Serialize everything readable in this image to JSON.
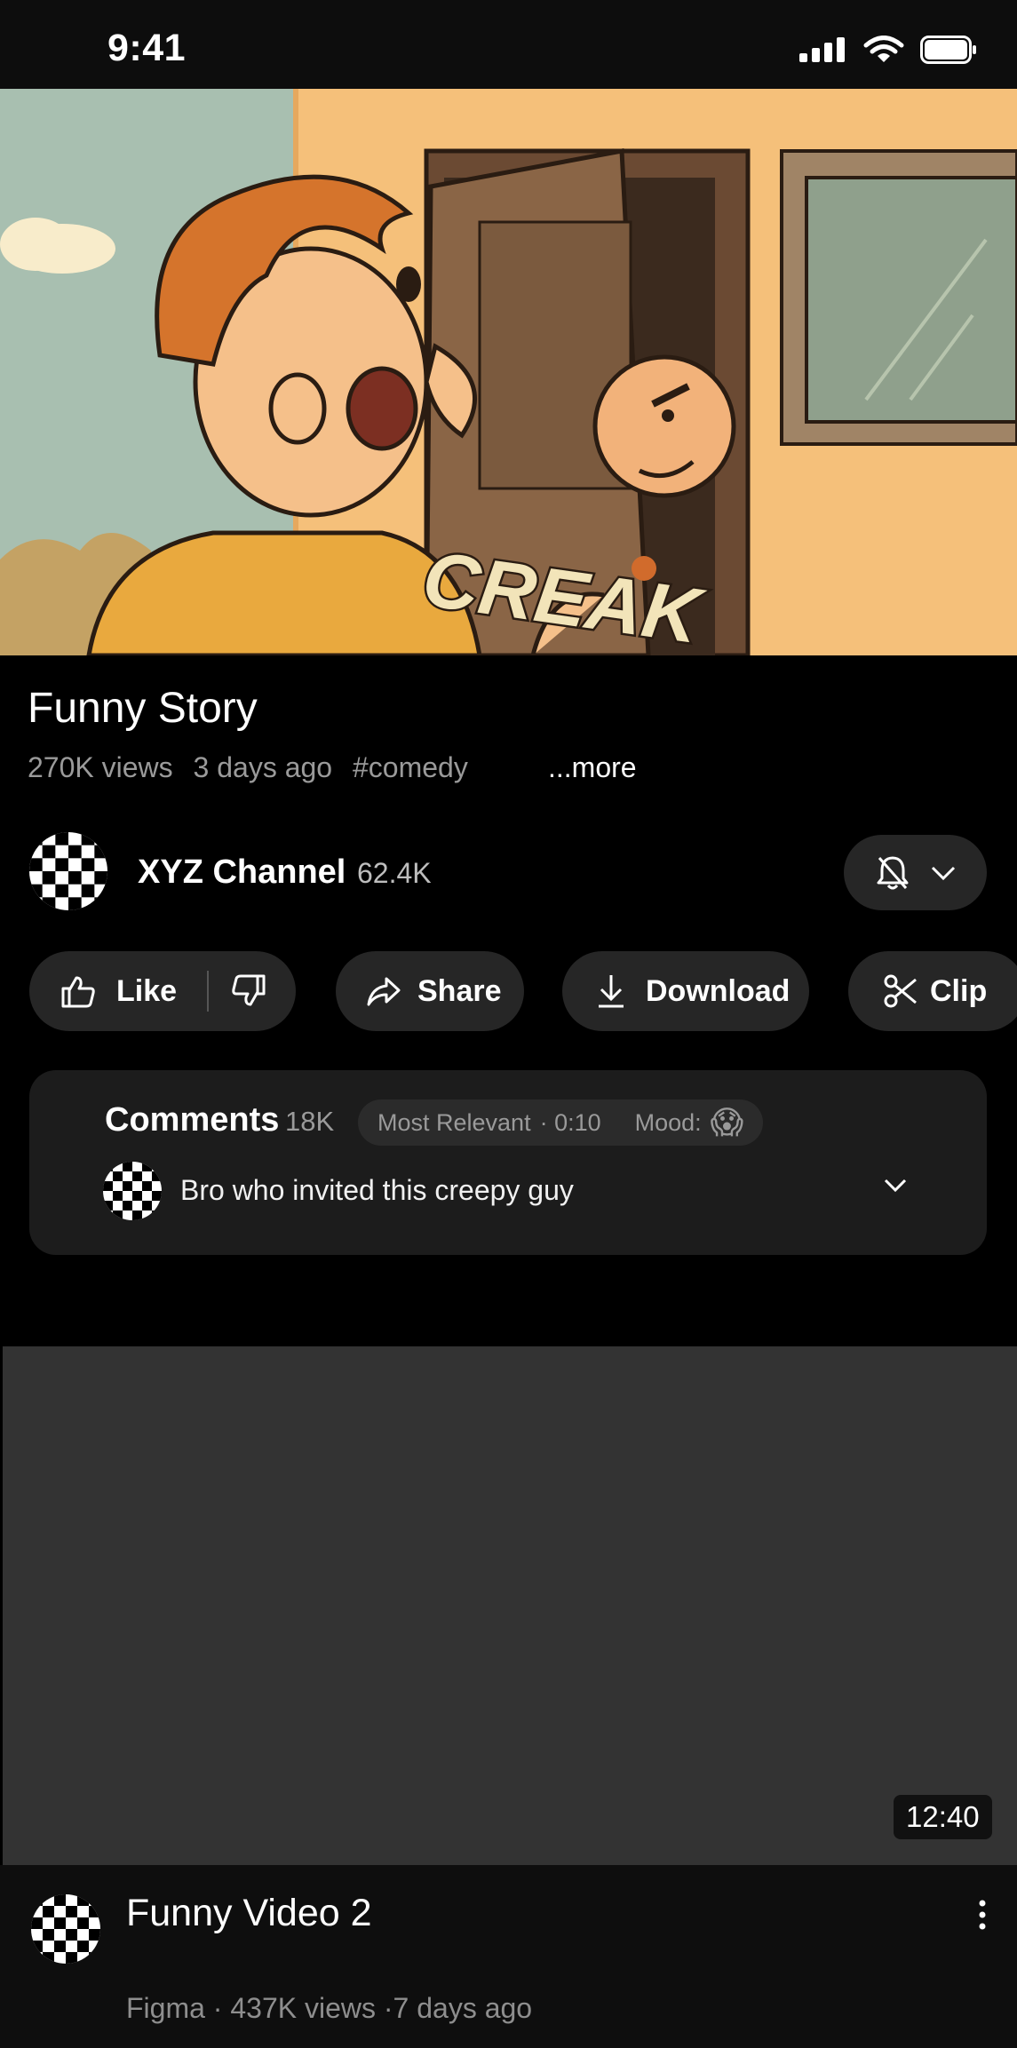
{
  "status_bar": {
    "time": "9:41"
  },
  "video": {
    "title": "Funny Story",
    "views": "270K views",
    "age": "3 days ago",
    "hashtag": "#comedy",
    "more": "...more",
    "overlay_text": "CREAK"
  },
  "channel": {
    "name": "XYZ Channel",
    "subscribers": "62.4K",
    "notify_icon": "bell-off-icon"
  },
  "actions": {
    "like": "Like",
    "share": "Share",
    "download": "Download",
    "clip": "Clip"
  },
  "comments": {
    "label": "Comments",
    "count": "18K",
    "sort": "Most Relevant",
    "timestamp": "· 0:10",
    "mood_label": "Mood:",
    "mood_emoji": "😱",
    "top_comment": "Bro who invited this creepy guy"
  },
  "next_video": {
    "duration": "12:40",
    "title": "Funny Video 2",
    "meta": "Figma · 437K views ·7 days ago"
  },
  "colors": {
    "background": "#000000",
    "pill": "#262626",
    "card": "#1c1c1c",
    "muted_text": "#9a9a9a"
  }
}
